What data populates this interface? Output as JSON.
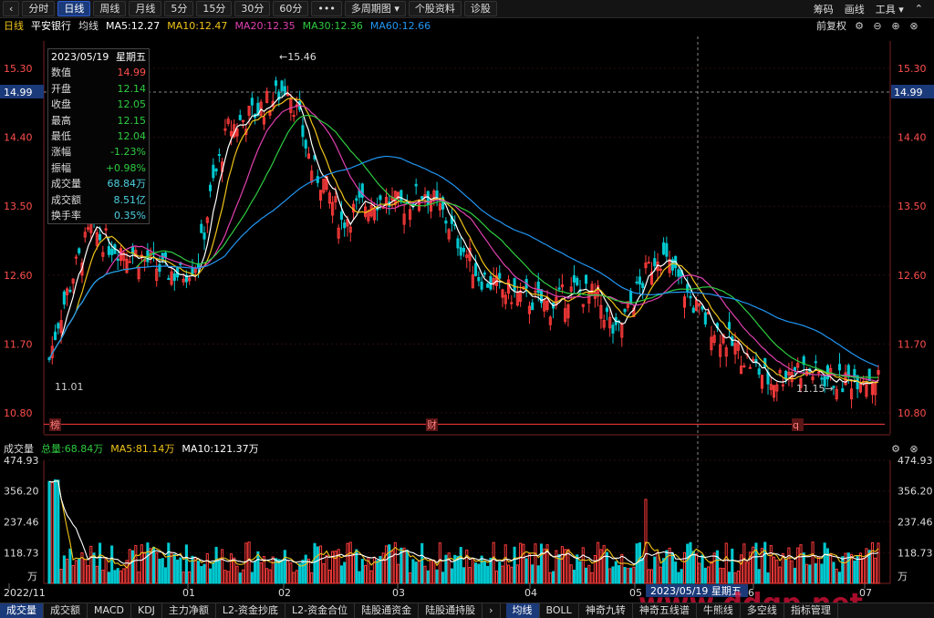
{
  "toolbar": {
    "back": "‹",
    "tabs": [
      {
        "label": "分时",
        "active": false
      },
      {
        "label": "日线",
        "active": true
      },
      {
        "label": "周线",
        "active": false
      },
      {
        "label": "月线",
        "active": false
      },
      {
        "label": "5分",
        "active": false
      },
      {
        "label": "15分",
        "active": false
      },
      {
        "label": "30分",
        "active": false
      },
      {
        "label": "60分",
        "active": false
      },
      {
        "label": "•••",
        "active": false
      },
      {
        "label": "多周期图 ▾",
        "active": false
      },
      {
        "label": "个股资料",
        "active": false
      },
      {
        "label": "诊股",
        "active": false
      }
    ],
    "right": [
      "筹码",
      "画线",
      "工具 ▾"
    ],
    "collapse": "⌃"
  },
  "title": {
    "period": "日线",
    "stock": "平安银行",
    "ma_label": "均线",
    "ma": [
      {
        "text": "MA5:12.27",
        "color": "#ffffff"
      },
      {
        "text": "MA10:12.47",
        "color": "#f0c419"
      },
      {
        "text": "MA20:12.35",
        "color": "#e040b0"
      },
      {
        "text": "MA30:12.36",
        "color": "#2ecc40"
      },
      {
        "text": "MA60:12.66",
        "color": "#2196f3"
      }
    ],
    "adjust": "前复权"
  },
  "info_box": {
    "date": "2023/05/19",
    "weekday": "星期五",
    "rows": [
      {
        "label": "数值",
        "value": "14.99",
        "color": "#ff4d4d"
      },
      {
        "label": "开盘",
        "value": "12.14",
        "color": "#2ecc40"
      },
      {
        "label": "收盘",
        "value": "12.05",
        "color": "#2ecc40"
      },
      {
        "label": "最高",
        "value": "12.15",
        "color": "#2ecc40"
      },
      {
        "label": "最低",
        "value": "12.04",
        "color": "#2ecc40"
      },
      {
        "label": "涨幅",
        "value": "-1.23%",
        "color": "#2ecc40"
      },
      {
        "label": "振幅",
        "value": "+0.98%",
        "color": "#2ecc40"
      },
      {
        "label": "成交量",
        "value": "68.84万",
        "color": "#4dd0e1"
      },
      {
        "label": "成交额",
        "value": "8.51亿",
        "color": "#4dd0e1"
      },
      {
        "label": "换手率",
        "value": "0.35%",
        "color": "#4dd0e1"
      }
    ]
  },
  "annotations": {
    "high": "15.46",
    "low_left": "11.01",
    "low_right": "11.15",
    "cursor_value": "14.99",
    "markers": [
      "榜",
      "财",
      "q"
    ]
  },
  "volume": {
    "title": "成交量",
    "total": "总量:68.84万",
    "ma5": "MA5:81.14万",
    "ma10": "MA10:121.37万",
    "unit": "万",
    "ticks": [
      "474.93",
      "356.20",
      "237.46",
      "118.73"
    ]
  },
  "x_axis": {
    "labels": [
      "2022/11",
      "01",
      "02",
      "03",
      "04",
      "05",
      "6",
      "07"
    ],
    "cursor_label": "2023/05/19 星期五"
  },
  "bottom_tabs_left": [
    "成交量",
    "成交额",
    "MACD",
    "KDJ",
    "主力净额",
    "L2-资金抄底",
    "L2-资金合位",
    "陆股通资金",
    "陆股通持股"
  ],
  "bottom_tabs_right": [
    "均线",
    "BOLL",
    "神奇九转",
    "神奇五线谱",
    "牛熊线",
    "多空线",
    "指标管理"
  ],
  "watermark": "www.ddgp.net",
  "chart_data": {
    "type": "candlestick",
    "title": "平安银行 日线",
    "ylim": [
      10.8,
      15.3
    ],
    "y_ticks": [
      15.3,
      14.4,
      13.5,
      12.6,
      11.7,
      10.8
    ],
    "support_line": 11.01,
    "volume_ylim": [
      0,
      474.93
    ],
    "series": [
      {
        "name": "MA5",
        "value_last": 12.27,
        "color": "#ffffff"
      },
      {
        "name": "MA10",
        "value_last": 12.47,
        "color": "#f0c419"
      },
      {
        "name": "MA20",
        "value_last": 12.35,
        "color": "#e040b0"
      },
      {
        "name": "MA30",
        "value_last": 12.36,
        "color": "#2ecc40"
      },
      {
        "name": "MA60",
        "value_last": 12.66,
        "color": "#2196f3"
      }
    ],
    "keypoints": [
      [
        0,
        11.5
      ],
      [
        3,
        12.0
      ],
      [
        8,
        12.6
      ],
      [
        14,
        13.2
      ],
      [
        20,
        13.0
      ],
      [
        28,
        12.9
      ],
      [
        36,
        12.7
      ],
      [
        44,
        12.6
      ],
      [
        50,
        12.8
      ],
      [
        55,
        13.8
      ],
      [
        60,
        14.5
      ],
      [
        68,
        14.7
      ],
      [
        75,
        14.9
      ],
      [
        80,
        15.1
      ],
      [
        84,
        14.6
      ],
      [
        88,
        14.0
      ],
      [
        92,
        13.8
      ],
      [
        98,
        13.3
      ],
      [
        104,
        13.5
      ],
      [
        110,
        13.6
      ],
      [
        118,
        13.5
      ],
      [
        126,
        13.7
      ],
      [
        132,
        13.4
      ],
      [
        138,
        13.0
      ],
      [
        144,
        12.6
      ],
      [
        152,
        12.4
      ],
      [
        160,
        12.3
      ],
      [
        168,
        12.2
      ],
      [
        176,
        12.4
      ],
      [
        184,
        12.3
      ],
      [
        190,
        11.8
      ],
      [
        196,
        12.3
      ],
      [
        204,
        12.9
      ],
      [
        210,
        12.6
      ],
      [
        218,
        12.1
      ],
      [
        226,
        11.8
      ],
      [
        234,
        11.5
      ],
      [
        242,
        11.2
      ],
      [
        250,
        11.4
      ],
      [
        258,
        11.3
      ],
      [
        266,
        11.2
      ],
      [
        272,
        11.3
      ],
      [
        278,
        11.25
      ]
    ]
  }
}
